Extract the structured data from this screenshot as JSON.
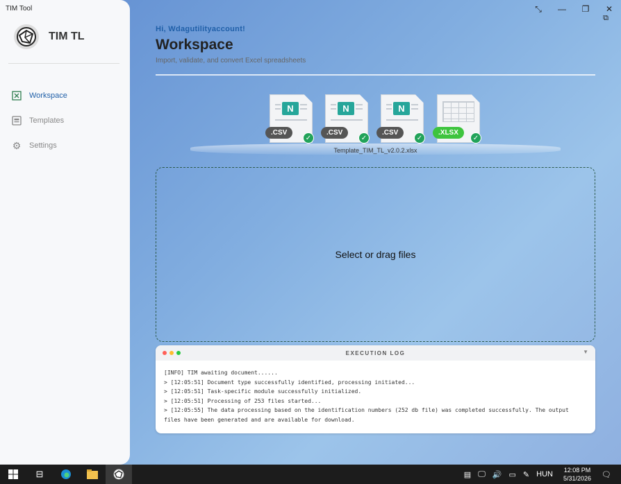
{
  "window": {
    "title": "TIM Tool"
  },
  "sidebar": {
    "brand": "TIM TL",
    "items": [
      {
        "label": "Workspace",
        "icon": "excel-icon",
        "active": true
      },
      {
        "label": "Templates",
        "icon": "template-icon",
        "active": false
      },
      {
        "label": "Settings",
        "icon": "gear-icon",
        "active": false
      }
    ]
  },
  "main": {
    "greeting": "Hi, Wdagutilityaccount!",
    "title": "Workspace",
    "subtitle": "Import, validate, and convert Excel spreadsheets"
  },
  "files": [
    {
      "ext": ".CSV",
      "type": "csv"
    },
    {
      "ext": ".CSV",
      "type": "csv"
    },
    {
      "ext": ".CSV",
      "type": "csv"
    },
    {
      "ext": ".XLSX",
      "type": "xlsx"
    }
  ],
  "template_filename": "Template_TIM_TL_v2.0.2.xlsx",
  "dropzone": {
    "label": "Select or drag files"
  },
  "log": {
    "title": "EXECUTION LOG",
    "lines": [
      "[INFO] TIM awaiting document......",
      "> [12:05:51] Document type successfully identified, processing initiated...",
      "> [12:05:51] Task-specific module successfully initialized.",
      "> [12:05:51] Processing of 253 files started...",
      "> [12:05:55] The data processing based on the identification numbers (252 db file) was completed successfully. The output files have been generated and are available for download."
    ]
  },
  "taskbar": {
    "language": "HUN",
    "time": "12:08 PM",
    "date": "5/31/2026"
  },
  "colors": {
    "accent": "#1f5fa8",
    "check": "#22a35a",
    "csv_badge": "#555555",
    "xlsx_badge": "#3ec43e"
  }
}
